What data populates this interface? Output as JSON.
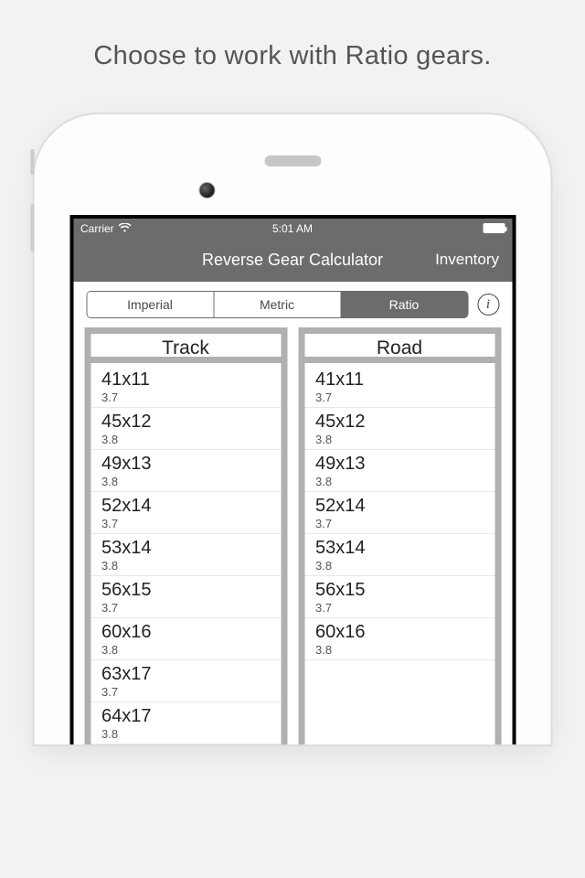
{
  "promo": "Choose to work with Ratio gears.",
  "statusBar": {
    "carrier": "Carrier",
    "time": "5:01 AM"
  },
  "nav": {
    "title": "Reverse Gear Calculator",
    "right": "Inventory"
  },
  "segmented": {
    "items": [
      {
        "label": "Imperial",
        "active": false
      },
      {
        "label": "Metric",
        "active": false
      },
      {
        "label": "Ratio",
        "active": true
      }
    ]
  },
  "columns": [
    {
      "title": "Track",
      "rows": [
        {
          "gear": "41x11",
          "ratio": "3.7"
        },
        {
          "gear": "45x12",
          "ratio": "3.8"
        },
        {
          "gear": "49x13",
          "ratio": "3.8"
        },
        {
          "gear": "52x14",
          "ratio": "3.7"
        },
        {
          "gear": "53x14",
          "ratio": "3.8"
        },
        {
          "gear": "56x15",
          "ratio": "3.7"
        },
        {
          "gear": "60x16",
          "ratio": "3.8"
        },
        {
          "gear": "63x17",
          "ratio": "3.7"
        },
        {
          "gear": "64x17",
          "ratio": "3.8"
        }
      ]
    },
    {
      "title": "Road",
      "rows": [
        {
          "gear": "41x11",
          "ratio": "3.7"
        },
        {
          "gear": "45x12",
          "ratio": "3.8"
        },
        {
          "gear": "49x13",
          "ratio": "3.8"
        },
        {
          "gear": "52x14",
          "ratio": "3.7"
        },
        {
          "gear": "53x14",
          "ratio": "3.8"
        },
        {
          "gear": "56x15",
          "ratio": "3.7"
        },
        {
          "gear": "60x16",
          "ratio": "3.8"
        }
      ]
    }
  ]
}
